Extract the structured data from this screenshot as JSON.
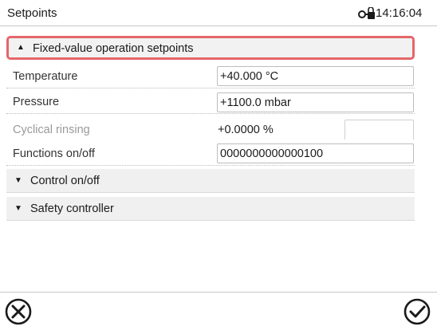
{
  "window": {
    "title": "Setpoints",
    "time": "14:16:04"
  },
  "sections": [
    {
      "label": "Fixed-value operation setpoints",
      "expanded": true
    },
    {
      "label": "Control on/off",
      "expanded": false
    },
    {
      "label": "Safety controller",
      "expanded": false
    }
  ],
  "rows": [
    {
      "label": "Temperature",
      "value": "+40.000 °C"
    },
    {
      "label": "Pressure",
      "value": "+1100.0 mbar"
    },
    {
      "label": "Cyclical rinsing",
      "value": "+0.0000 %"
    },
    {
      "label": "Functions on/off",
      "value": "0000000000000100"
    }
  ],
  "icons": {
    "status": "lock-icon",
    "cancel": "cancel-icon",
    "confirm": "confirm-icon"
  },
  "colors": {
    "highlight": "#e5666b",
    "section_bg": "#f0f0f0"
  }
}
